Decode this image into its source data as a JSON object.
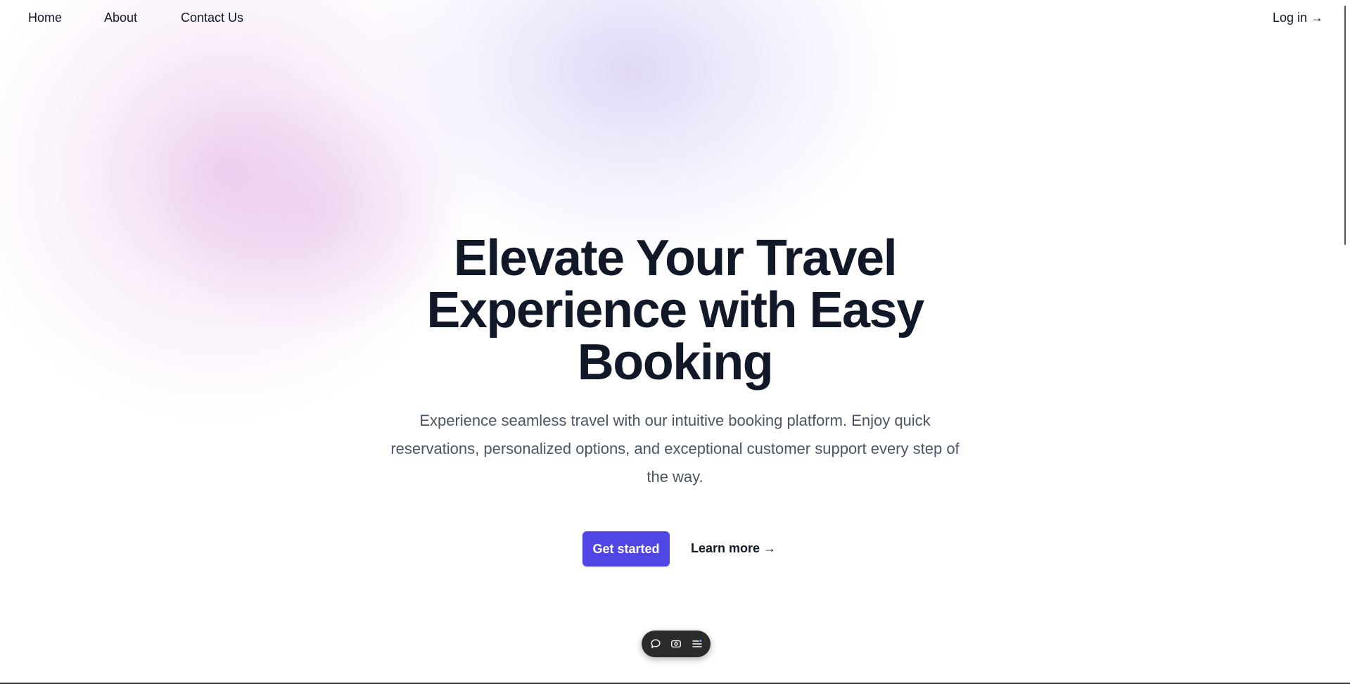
{
  "nav": {
    "items": [
      {
        "label": "Home"
      },
      {
        "label": "About"
      },
      {
        "label": "Contact Us"
      }
    ],
    "login_label": "Log in →"
  },
  "hero": {
    "title": "Elevate Your Travel Experience with Easy Booking",
    "subtitle": "Experience seamless travel with our intuitive booking platform. Enjoy quick reservations, personalized options, and exceptional customer support every step of the way."
  },
  "actions": {
    "primary_label": "Get started",
    "secondary_label": "Learn more →"
  },
  "toolbar": {
    "icons": [
      "comment-icon",
      "camera-toggle-icon",
      "menu-list-icon"
    ]
  },
  "colors": {
    "accent": "#4f46e5",
    "heading": "#111827",
    "body_text": "#4b5563",
    "toolbar_bg": "#2b2b2b",
    "blob_pink": "#e8c4ea",
    "blob_purple": "#d6ccf4"
  }
}
